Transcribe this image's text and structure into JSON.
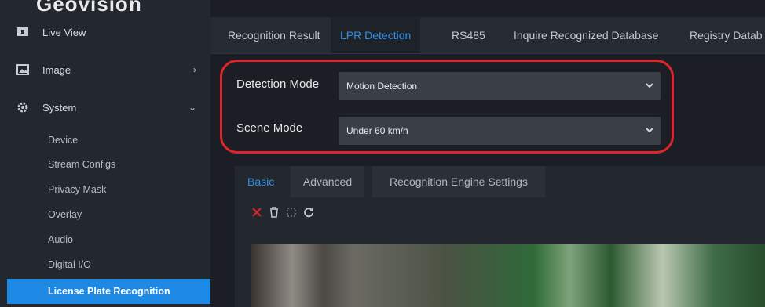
{
  "sidebar": {
    "logo": "Geovision",
    "items": [
      {
        "label": "Live View",
        "icon": "tv-icon"
      },
      {
        "label": "Image",
        "icon": "image-icon",
        "chevron": "›"
      },
      {
        "label": "System",
        "icon": "gear-icon",
        "chevron": "⌄"
      }
    ],
    "sub_items": [
      {
        "label": "Device"
      },
      {
        "label": "Stream Configs"
      },
      {
        "label": "Privacy Mask"
      },
      {
        "label": "Overlay"
      },
      {
        "label": "Audio"
      },
      {
        "label": "Digital I/O"
      },
      {
        "label": "License Plate Recognition"
      }
    ]
  },
  "tabs": [
    {
      "label": "Recognition Result"
    },
    {
      "label": "LPR Detection"
    },
    {
      "label": "RS485"
    },
    {
      "label": "Inquire Recognized Database"
    },
    {
      "label": "Registry Datab"
    }
  ],
  "form": {
    "detection_mode_label": "Detection Mode",
    "detection_mode_value": "Motion Detection",
    "scene_mode_label": "Scene Mode",
    "scene_mode_value": "Under 60 km/h"
  },
  "subtabs": [
    {
      "label": "Basic"
    },
    {
      "label": "Advanced"
    },
    {
      "label": "Recognition Engine Settings"
    }
  ],
  "colors": {
    "accent": "#1e88e5",
    "highlight": "#e0242b"
  }
}
